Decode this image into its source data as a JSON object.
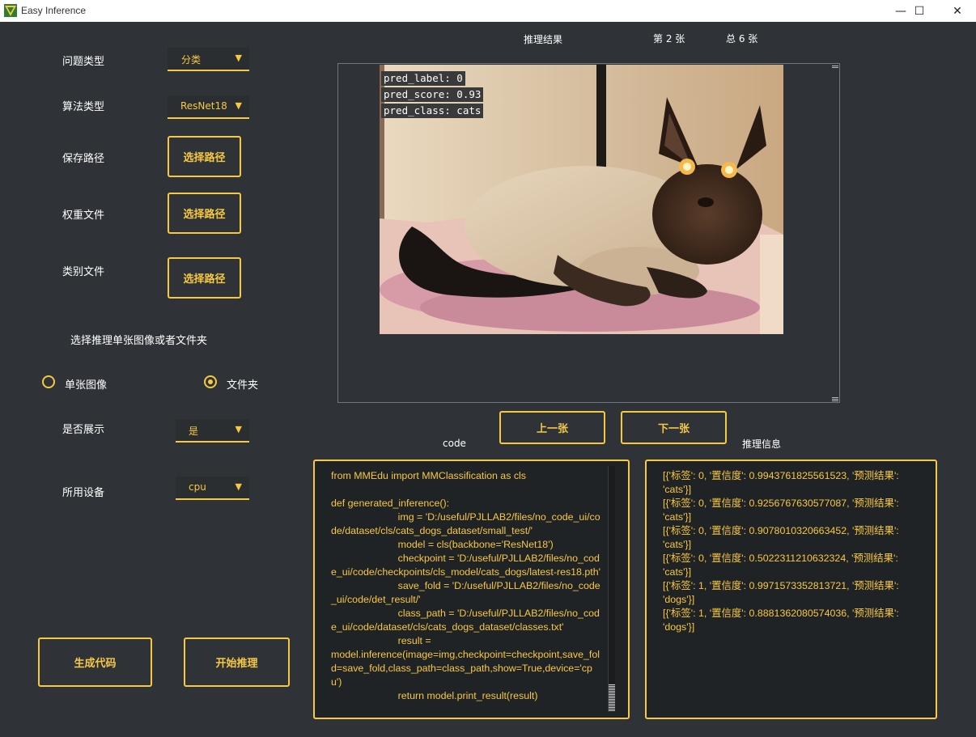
{
  "window": {
    "title": "Easy Inference",
    "minimize_label": "—",
    "maximize_label": "☐",
    "close_label": "✕"
  },
  "form": {
    "problem_type": {
      "label": "问题类型",
      "value": "分类"
    },
    "algo_type": {
      "label": "算法类型",
      "value": "ResNet18"
    },
    "save_path": {
      "label": "保存路径",
      "button": "选择路径"
    },
    "weights_file": {
      "label": "权重文件",
      "button": "选择路径"
    },
    "classes_file": {
      "label": "类别文件",
      "button": "选择路径"
    },
    "select_mode_label": "选择推理单张图像或者文件夹",
    "radio_single": {
      "label": "单张图像",
      "checked": false
    },
    "radio_folder": {
      "label": "文件夹",
      "checked": true
    },
    "show_result": {
      "label": "是否展示",
      "value": "是"
    },
    "device": {
      "label": "所用设备",
      "value": "cpu"
    },
    "generate_code_button": "生成代码",
    "start_inference_button": "开始推理"
  },
  "result": {
    "title": "推理结果",
    "current": "第 2 张",
    "total": "总 6 张",
    "pred_label": "pred_label: 0",
    "pred_score": "pred_score: 0.93",
    "pred_class": "pred_class: cats",
    "prev_button": "上一张",
    "next_button": "下一张"
  },
  "code": {
    "title": "code",
    "text": "from MMEdu import MMClassification as cls\n\ndef generated_inference():\n                        img = 'D:/useful/PJLLAB2/files/no_code_ui/code/dataset/cls/cats_dogs_dataset/small_test/'\n                        model = cls(backbone='ResNet18')\n                        checkpoint = 'D:/useful/PJLLAB2/files/no_code_ui/code/checkpoints/cls_model/cats_dogs/latest-res18.pth'\n                        save_fold = 'D:/useful/PJLLAB2/files/no_code_ui/code/det_result/'\n                        class_path = 'D:/useful/PJLLAB2/files/no_code_ui/code/dataset/cls/cats_dogs_dataset/classes.txt'\n                        result =\nmodel.inference(image=img,checkpoint=checkpoint,save_fold=save_fold,class_path=class_path,show=True,device='cpu')\n                        return model.print_result(result)"
  },
  "info": {
    "title": "推理信息",
    "text": "[{'标签': 0, '置信度': 0.9943761825561523, '预测结果': 'cats'}]\n[{'标签': 0, '置信度': 0.9256767630577087, '预测结果': 'cats'}]\n[{'标签': 0, '置信度': 0.9078010320663452, '预测结果': 'cats'}]\n[{'标签': 0, '置信度': 0.5022311210632324, '预测结果': 'cats'}]\n[{'标签': 1, '置信度': 0.9971573352813721, '预测结果': 'dogs'}]\n[{'标签': 1, '置信度': 0.8881362080574036, '预测结果': 'dogs'}]"
  },
  "colors": {
    "accent": "#f7c842",
    "background": "#2f3337",
    "panel": "#202326"
  }
}
